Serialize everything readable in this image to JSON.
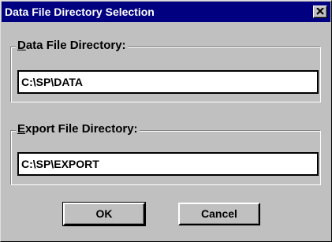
{
  "window": {
    "title": "Data File Directory Selection",
    "close_glyph": "✕"
  },
  "data_group": {
    "label_mnemonic": "D",
    "label_rest": "ata File Directory:",
    "value": "C:\\SP\\DATA"
  },
  "export_group": {
    "label_mnemonic": "E",
    "label_rest": "xport File Directory:",
    "value": "C:\\SP\\EXPORT"
  },
  "buttons": {
    "ok_label": "OK",
    "cancel_label": "Cancel"
  },
  "colors": {
    "titlebar": "#000080",
    "face": "#c0c0c0"
  },
  "icons": {
    "close": "close-icon"
  }
}
